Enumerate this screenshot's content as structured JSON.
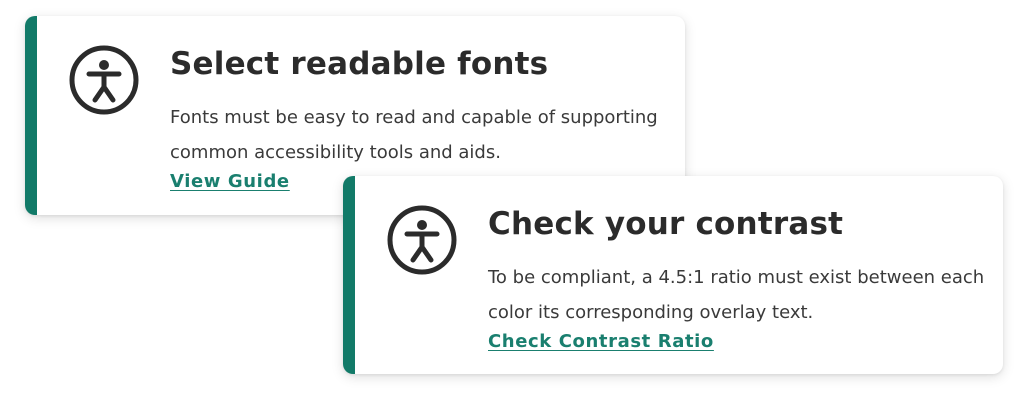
{
  "colors": {
    "accent": "#127a68",
    "link": "#1a7f6f",
    "title": "#2b2b2b",
    "text": "#3a3a3a"
  },
  "cards": [
    {
      "icon": "accessibility-icon",
      "title": "Select readable fonts",
      "description": "Fonts must be easy to read and capable of supporting common accessibility tools and aids.",
      "link_label": "View Guide"
    },
    {
      "icon": "accessibility-icon",
      "title": "Check your contrast",
      "description": "To be compliant, a 4.5:1 ratio must exist between each color its corresponding overlay text.",
      "link_label": "Check Contrast Ratio"
    }
  ]
}
